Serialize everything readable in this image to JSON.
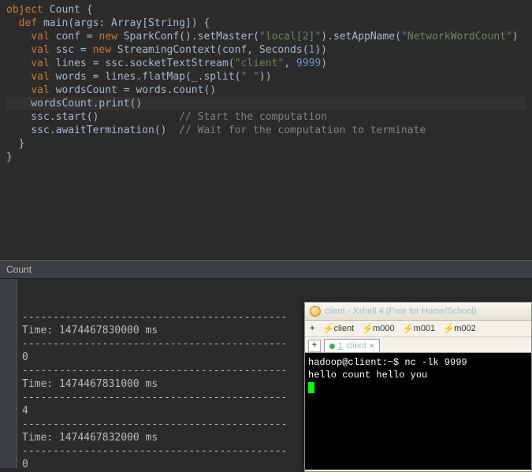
{
  "editor": {
    "lines": [
      {
        "tokens": [
          [
            "kw",
            "object"
          ],
          [
            "ident",
            " Count {"
          ]
        ]
      },
      {
        "tokens": [
          [
            "ident",
            "  "
          ],
          [
            "kw",
            "def"
          ],
          [
            "ident",
            " main(args: Array["
          ],
          [
            "type",
            "String"
          ],
          [
            "ident",
            "]) {"
          ]
        ]
      },
      {
        "tokens": [
          [
            "ident",
            "    "
          ],
          [
            "kw",
            "val"
          ],
          [
            "ident",
            " conf = "
          ],
          [
            "kw",
            "new"
          ],
          [
            "ident",
            " SparkConf().setMaster("
          ],
          [
            "str",
            "\"local[2]\""
          ],
          [
            "ident",
            ").setAppName("
          ],
          [
            "str",
            "\"NetworkWordCount\""
          ],
          [
            "ident",
            ")"
          ]
        ]
      },
      {
        "tokens": [
          [
            "ident",
            "    "
          ],
          [
            "kw",
            "val"
          ],
          [
            "ident",
            " ssc = "
          ],
          [
            "kw",
            "new"
          ],
          [
            "ident",
            " StreamingContext(conf, Seconds("
          ],
          [
            "num",
            "1"
          ],
          [
            "ident",
            "))"
          ]
        ]
      },
      {
        "tokens": [
          [
            "ident",
            ""
          ]
        ]
      },
      {
        "tokens": [
          [
            "ident",
            "    "
          ],
          [
            "kw",
            "val"
          ],
          [
            "ident",
            " lines = ssc.socketTextStream("
          ],
          [
            "str",
            "\"client\""
          ],
          [
            "ident",
            ", "
          ],
          [
            "num",
            "9999"
          ],
          [
            "ident",
            ")"
          ]
        ]
      },
      {
        "tokens": [
          [
            "ident",
            ""
          ]
        ]
      },
      {
        "tokens": [
          [
            "ident",
            "    "
          ],
          [
            "kw",
            "val"
          ],
          [
            "ident",
            " words = lines.flatMap(_.split("
          ],
          [
            "str",
            "\" \""
          ],
          [
            "ident",
            "))"
          ]
        ]
      },
      {
        "tokens": [
          [
            "ident",
            "    "
          ],
          [
            "kw",
            "val"
          ],
          [
            "ident",
            " wordsCount = words.count()"
          ]
        ]
      },
      {
        "tokens": [
          [
            "ident",
            ""
          ]
        ]
      },
      {
        "tokens": [
          [
            "ident",
            "    wordsCount.print()"
          ]
        ],
        "caret": true
      },
      {
        "tokens": [
          [
            "ident",
            ""
          ]
        ]
      },
      {
        "tokens": [
          [
            "ident",
            "    ssc.start()             "
          ],
          [
            "comment",
            "// Start the computation"
          ]
        ]
      },
      {
        "tokens": [
          [
            "ident",
            "    ssc.awaitTermination()  "
          ],
          [
            "comment",
            "// Wait for the computation to terminate"
          ]
        ]
      },
      {
        "tokens": [
          [
            "ident",
            "  }"
          ]
        ]
      },
      {
        "tokens": [
          [
            "ident",
            "}"
          ]
        ]
      }
    ]
  },
  "console": {
    "title": "Count",
    "lines": [
      "-------------------------------------------",
      "Time: 1474467830000 ms",
      "-------------------------------------------",
      "0",
      "",
      "-------------------------------------------",
      "Time: 1474467831000 ms",
      "-------------------------------------------",
      "4",
      "",
      "-------------------------------------------",
      "Time: 1474467832000 ms",
      "-------------------------------------------",
      "0"
    ]
  },
  "xshell": {
    "title": "client - Xshell 4 (Free for Home/School)",
    "toolbar": [
      "client",
      "m000",
      "m001",
      "m002"
    ],
    "tab_num": "1",
    "tab_label": "client",
    "terminal": [
      "hadoop@client:~$ nc -lk 9999",
      "hello count hello you"
    ]
  }
}
